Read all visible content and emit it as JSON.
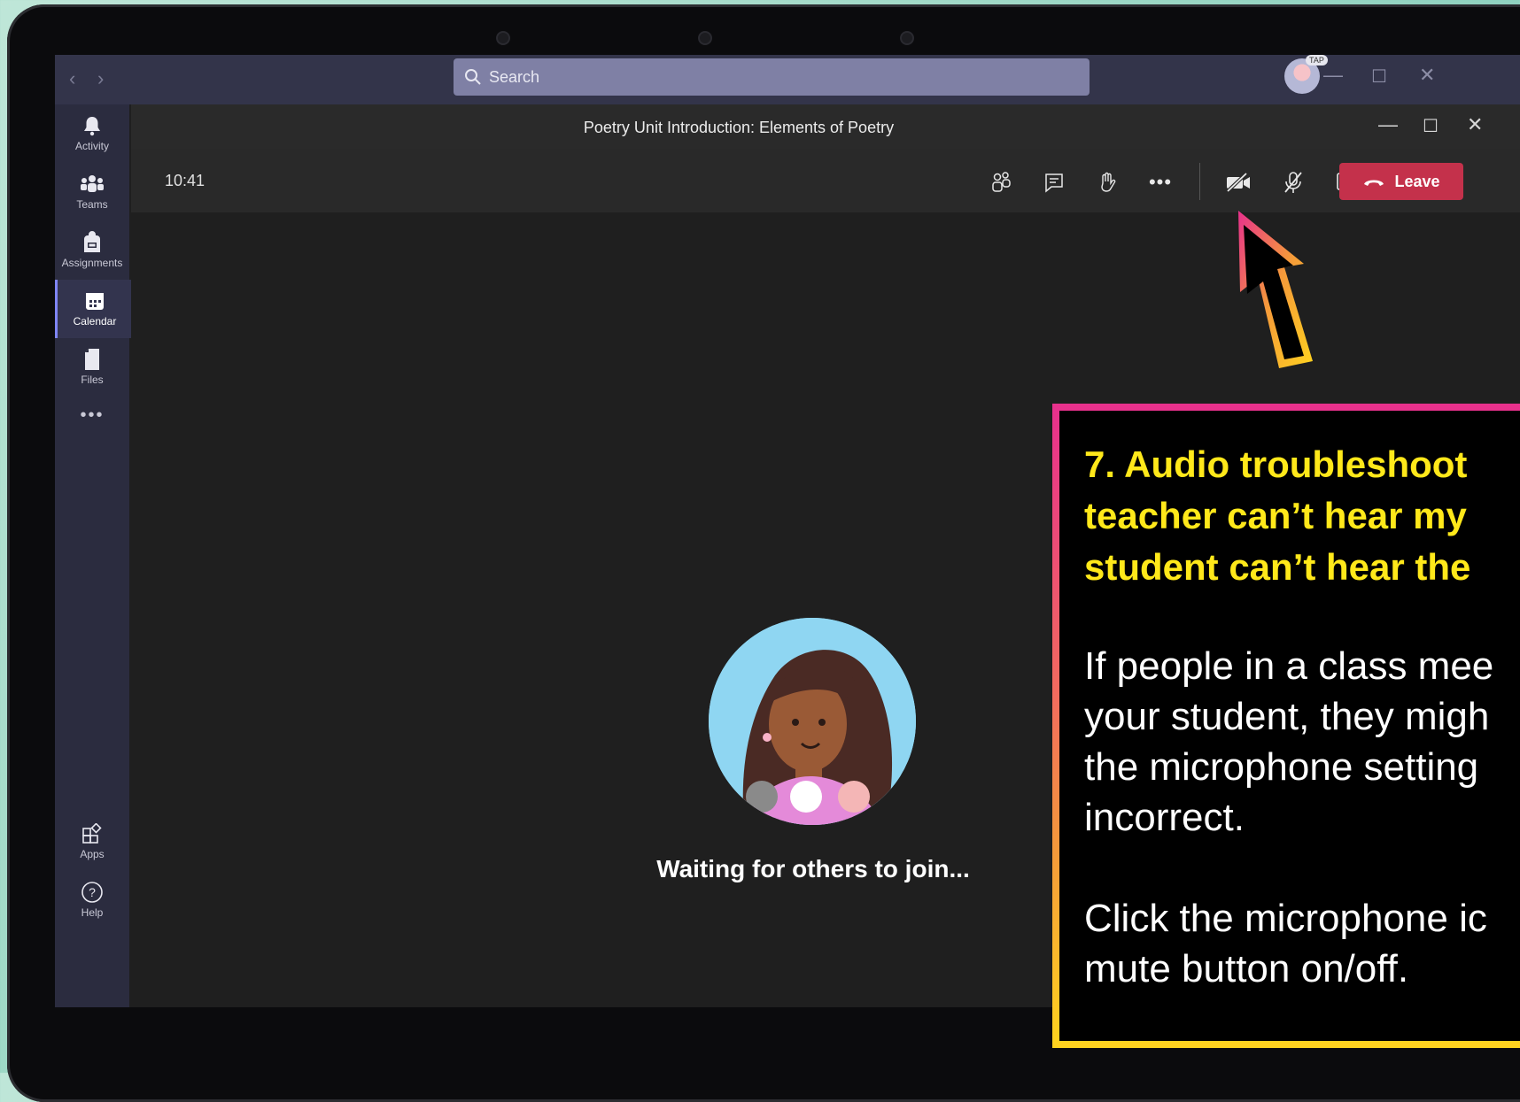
{
  "window": {
    "search_placeholder": "Search",
    "avatar_badge": "TAP"
  },
  "rail": {
    "items": [
      {
        "label": "Activity",
        "icon": "bell-icon"
      },
      {
        "label": "Teams",
        "icon": "teams-icon"
      },
      {
        "label": "Assignments",
        "icon": "backpack-icon"
      },
      {
        "label": "Calendar",
        "icon": "calendar-icon",
        "active": true
      },
      {
        "label": "Files",
        "icon": "file-icon"
      },
      {
        "label": "Apps",
        "icon": "apps-icon"
      },
      {
        "label": "Help",
        "icon": "help-icon"
      }
    ],
    "more": "•••"
  },
  "meeting": {
    "title": "Poetry Unit Introduction: Elements of Poetry",
    "time": "10:41",
    "leave_label": "Leave",
    "waiting_text": "Waiting for others to join..."
  },
  "callout": {
    "heading": "7. Audio troubleshoot\nteacher can’t hear my\nstudent can’t hear the",
    "body": "If people in a class mee\nyour student, they migh\nthe microphone setting\nincorrect.\n\nClick the microphone ic\nmute button on/off."
  },
  "colors": {
    "leave_button": "#c4314b",
    "callout_heading": "#ffe81a",
    "accent": "#7f85f5"
  }
}
